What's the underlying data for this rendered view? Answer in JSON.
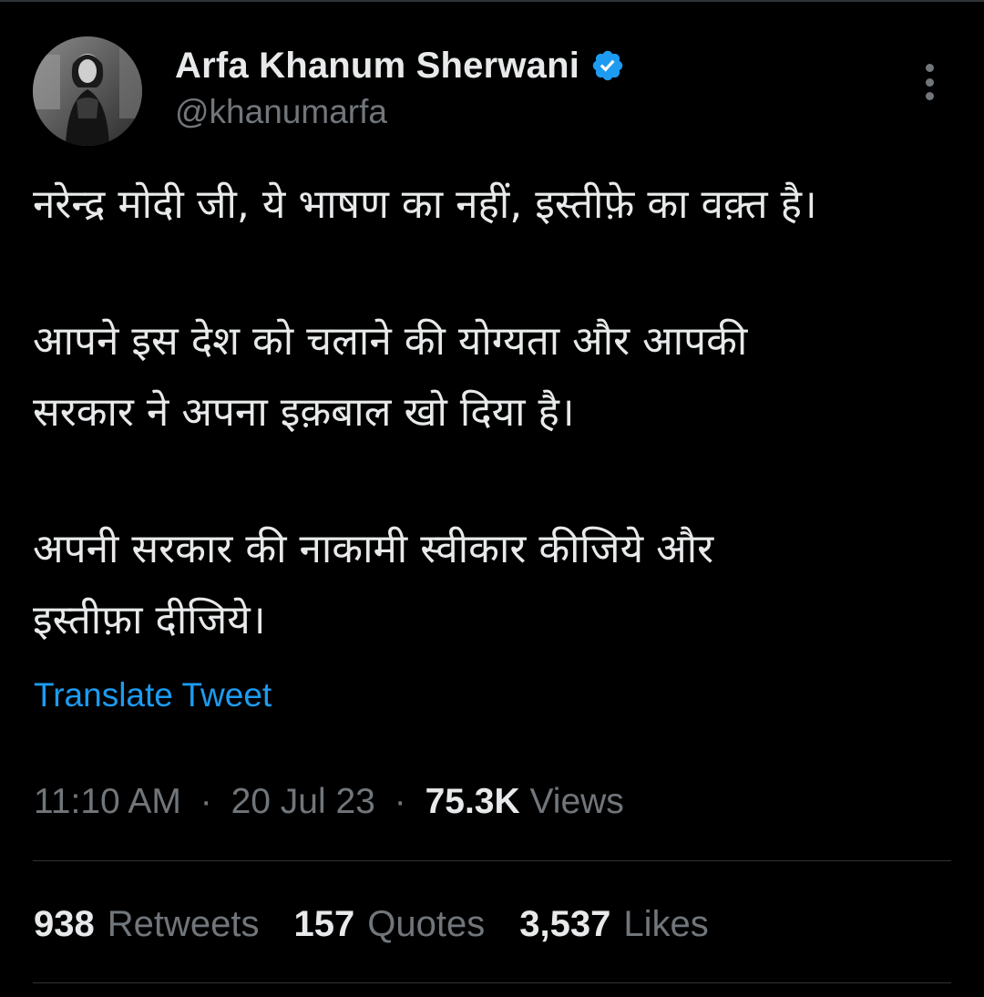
{
  "colors": {
    "background": "#000000",
    "text_primary": "#e7e9ea",
    "text_secondary": "#71767b",
    "link": "#1d9bf0",
    "verified_badge": "#1d9bf0",
    "divider": "#2f3336"
  },
  "author": {
    "display_name": "Arfa Khanum Sherwani",
    "handle": "@khanumarfa",
    "verified": true,
    "avatar_icon": "profile-photo"
  },
  "tweet": {
    "paragraphs": [
      [
        "नरेन्द्र मोदी जी, ये भाषण का नहीं, इस्तीफ़े का वक़्त है।"
      ],
      [
        "आपने इस देश को चलाने की योग्यता और आपकी",
        "सरकार ने अपना इक़बाल खो दिया है।"
      ],
      [
        "अपनी सरकार की नाकामी स्वीकार कीजिये और",
        "इस्तीफ़ा दीजिये।"
      ]
    ],
    "translate_label": "Translate Tweet",
    "time": "11:10 AM",
    "separator": "·",
    "date": "20 Jul 23",
    "views_count": "75.3K",
    "views_label": "Views"
  },
  "stats": {
    "retweets": {
      "count": "938",
      "label": "Retweets"
    },
    "quotes": {
      "count": "157",
      "label": "Quotes"
    },
    "likes": {
      "count": "3,537",
      "label": "Likes"
    }
  },
  "icons": {
    "more": "more-options-icon",
    "verified": "verified-badge-icon"
  }
}
